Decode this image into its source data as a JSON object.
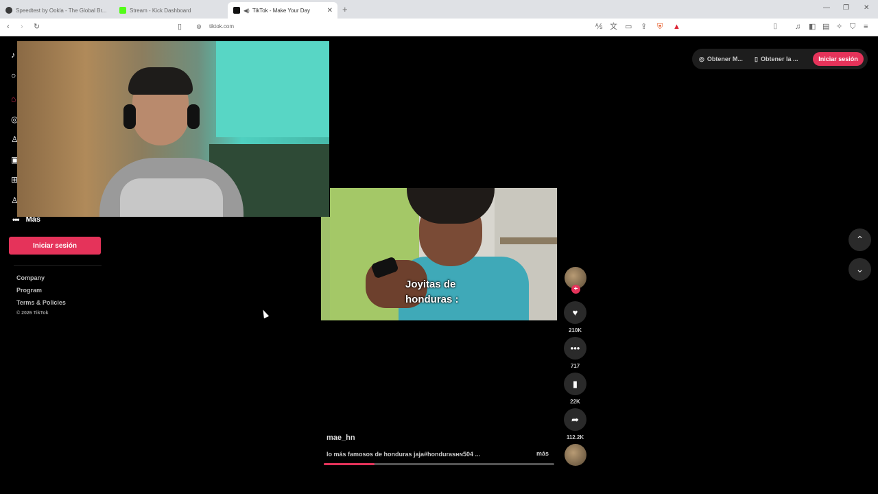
{
  "browser": {
    "tabs": [
      {
        "title": "Speedtest by Ookla - The Global Br...",
        "favicon_color": "#3a3a3a",
        "active": false
      },
      {
        "title": "Stream - Kick Dashboard",
        "favicon_color": "#53fc18",
        "active": false
      },
      {
        "title": "TikTok - Make Your Day",
        "favicon_color": "#111111",
        "active": true
      }
    ],
    "new_tab": "+",
    "url": "tiktok.com"
  },
  "sidebar": {
    "more_label": "Más",
    "login_button": "Iniciar sesión",
    "footer_links": [
      "Company",
      "Program",
      "Terms & Policies"
    ],
    "copyright": "© 2026 TikTok"
  },
  "header": {
    "get_coins": "Obtener M...",
    "get_app": "Obtener la ...",
    "login_button": "Iniciar sesión"
  },
  "video": {
    "caption_overlay": "Joyitas de\nhonduras :",
    "username": "mae_hn",
    "description": "lo más famosos de honduras jaja#hondurasʜɴ504 ...",
    "more_label": "más",
    "progress_fraction": 0.22
  },
  "actions": {
    "likes": "210K",
    "comments": "717",
    "saves": "22K",
    "shares": "112.2K"
  },
  "colors": {
    "accent": "#e5335a",
    "background": "#000000"
  }
}
